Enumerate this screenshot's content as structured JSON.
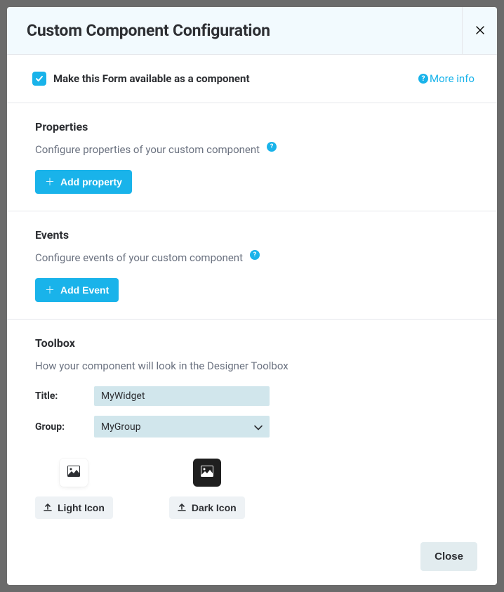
{
  "modal": {
    "title": "Custom Component Configuration",
    "checkbox_label": "Make this Form available as a component",
    "checkbox_checked": true,
    "more_info_label": "More info"
  },
  "properties": {
    "title": "Properties",
    "desc": "Configure properties of your custom component",
    "add_button": "Add property"
  },
  "events": {
    "title": "Events",
    "desc": "Configure events of your custom component",
    "add_button": "Add Event"
  },
  "toolbox": {
    "title": "Toolbox",
    "desc": "How your component will look in the Designer Toolbox",
    "title_field_label": "Title:",
    "title_field_value": "MyWidget",
    "group_field_label": "Group:",
    "group_field_value": "MyGroup",
    "light_icon_button": "Light Icon",
    "dark_icon_button": "Dark Icon"
  },
  "footer": {
    "close_label": "Close"
  }
}
